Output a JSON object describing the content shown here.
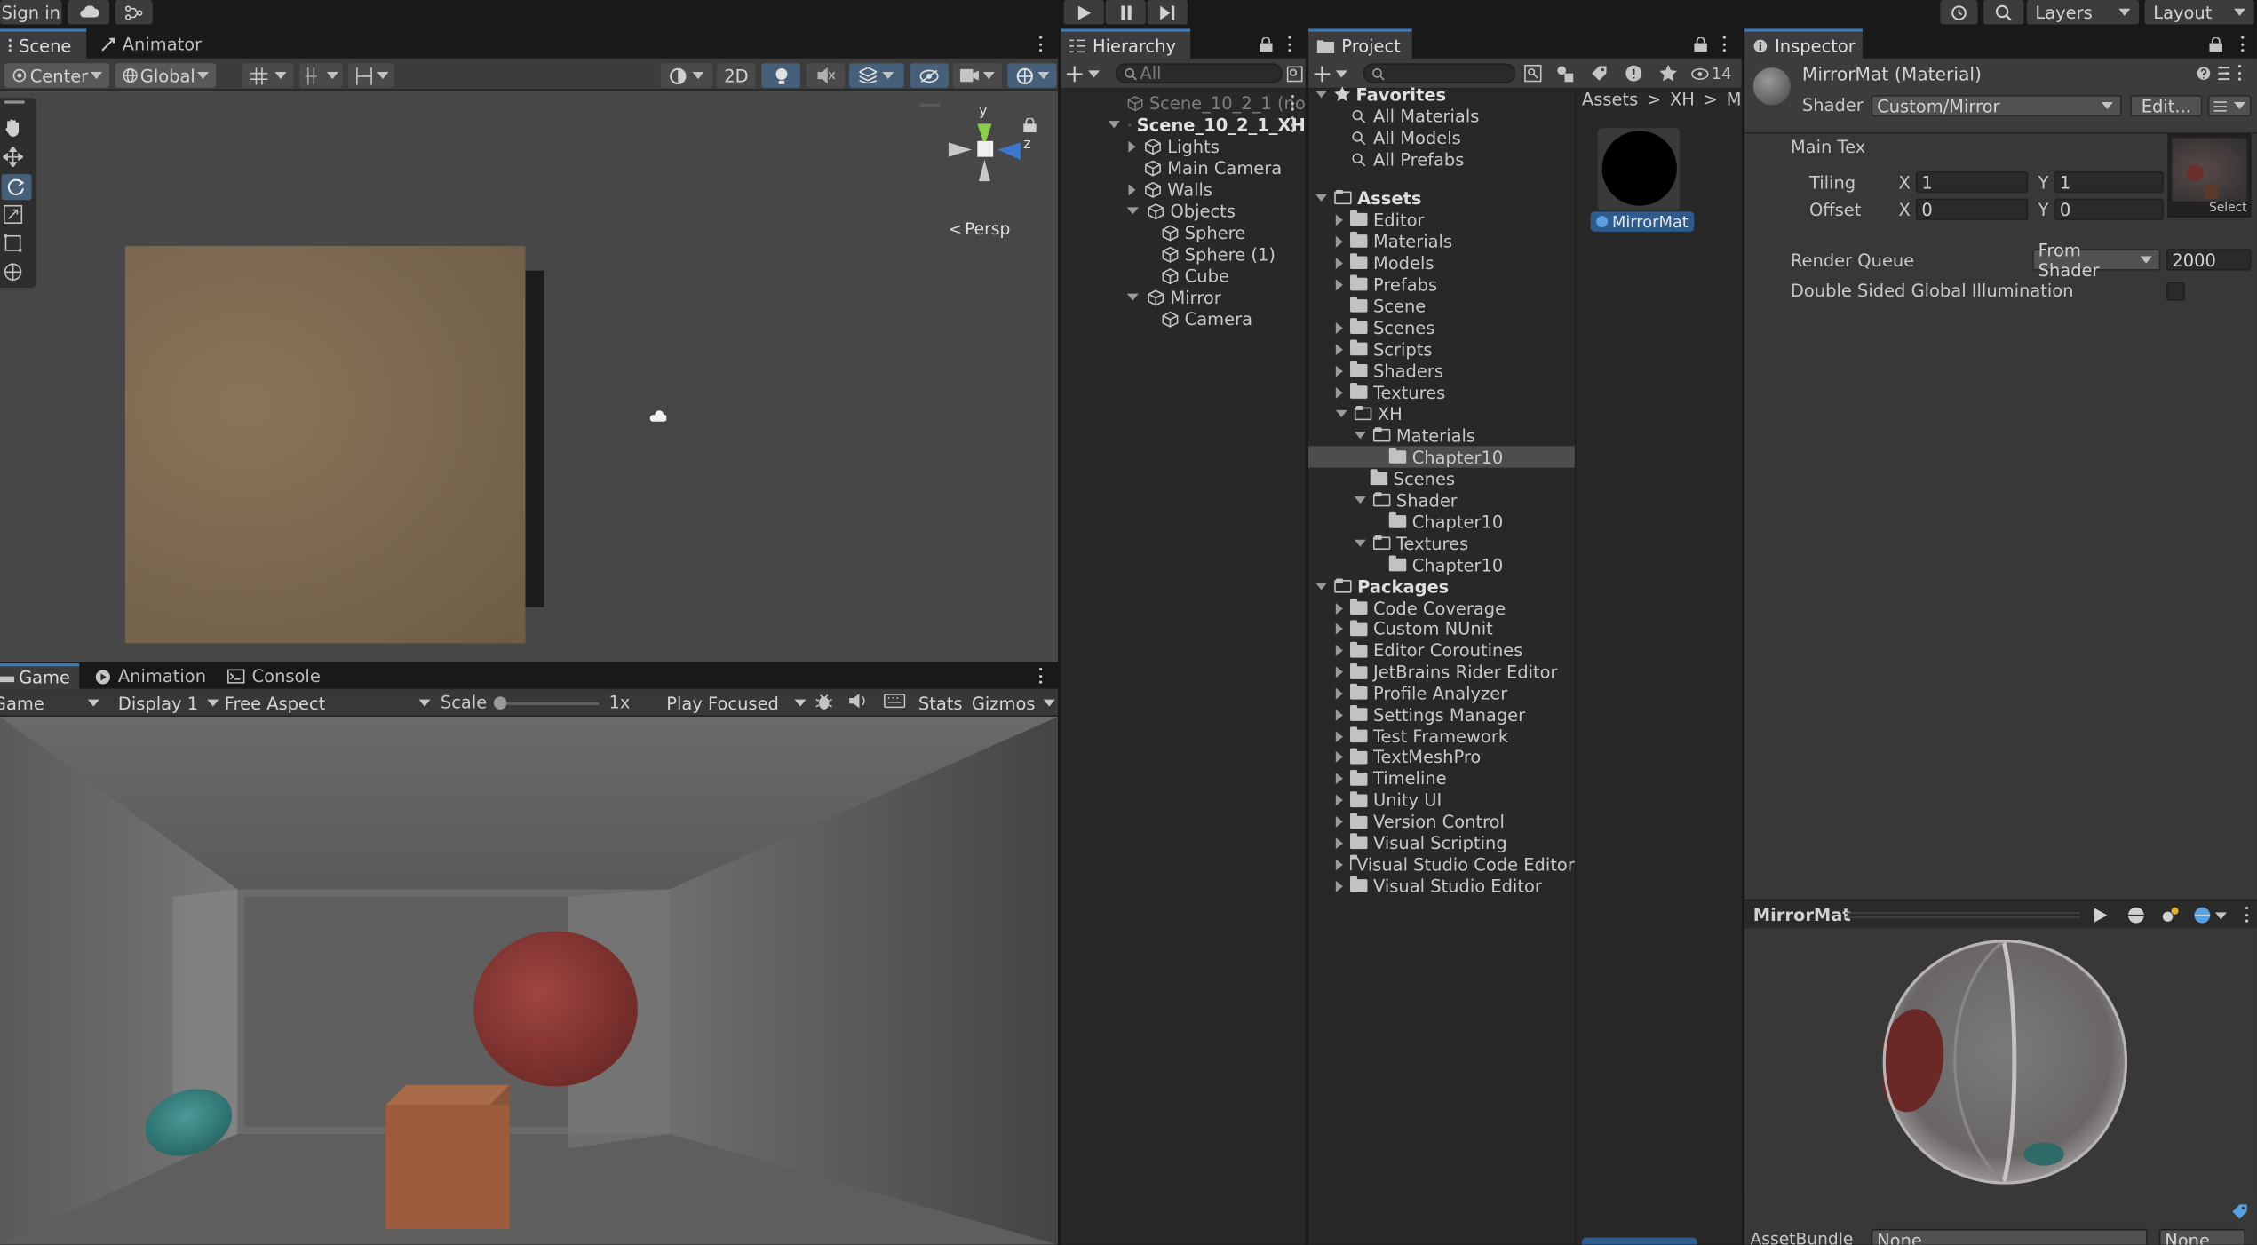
{
  "topbar": {
    "sign_in": "Sign in",
    "layers": "Layers",
    "layout": "Layout"
  },
  "scene": {
    "tabs": [
      "Scene",
      "Animator"
    ],
    "pivot": "Center",
    "space": "Global",
    "mode_2d": "2D",
    "persp": "Persp",
    "gizmo": {
      "y": "y",
      "z": "z"
    }
  },
  "game": {
    "tabs": [
      "Game",
      "Animation",
      "Console"
    ],
    "view": "Game",
    "display": "Display 1",
    "aspect": "Free Aspect",
    "scale_label": "Scale",
    "scale_value": "1x",
    "play_mode": "Play Focused",
    "stats": "Stats",
    "gizmos": "Gizmos"
  },
  "hierarchy": {
    "title": "Hierarchy",
    "search_placeholder": "All",
    "items": [
      {
        "label": "Scene_10_2_1 (no",
        "depth": 0
      },
      {
        "label": "Scene_10_2_1_XH",
        "depth": 0
      },
      {
        "label": "Lights",
        "depth": 1
      },
      {
        "label": "Main Camera",
        "depth": 1
      },
      {
        "label": "Walls",
        "depth": 1
      },
      {
        "label": "Objects",
        "depth": 1
      },
      {
        "label": "Sphere",
        "depth": 2
      },
      {
        "label": "Sphere (1)",
        "depth": 2
      },
      {
        "label": "Cube",
        "depth": 2
      },
      {
        "label": "Mirror",
        "depth": 1
      },
      {
        "label": "Camera",
        "depth": 2
      }
    ]
  },
  "project": {
    "title": "Project",
    "hidden_count": "14",
    "breadcrumb": [
      "Assets",
      "XH",
      "Mate"
    ],
    "favorites": {
      "label": "Favorites",
      "items": [
        "All Materials",
        "All Models",
        "All Prefabs"
      ]
    },
    "assets": {
      "label": "Assets",
      "items": [
        "Editor",
        "Materials",
        "Models",
        "Prefabs",
        "Scene",
        "Scenes",
        "Scripts",
        "Shaders",
        "Textures",
        "XH",
        "Materials",
        "Chapter10",
        "Scenes",
        "Shader",
        "Chapter10",
        "Textures",
        "Chapter10"
      ]
    },
    "packages": {
      "label": "Packages",
      "items": [
        "Code Coverage",
        "Custom NUnit",
        "Editor Coroutines",
        "JetBrains Rider Editor",
        "Profile Analyzer",
        "Settings Manager",
        "Test Framework",
        "TextMeshPro",
        "Timeline",
        "Unity UI",
        "Version Control",
        "Visual Scripting",
        "Visual Studio Code Editor",
        "Visual Studio Editor"
      ]
    },
    "asset_item": "MirrorMat"
  },
  "inspector": {
    "title": "Inspector",
    "object_name": "MirrorMat (Material)",
    "shader_label": "Shader",
    "shader_value": "Custom/Mirror",
    "edit_button": "Edit...",
    "main_tex": "Main Tex",
    "tiling_label": "Tiling",
    "offset_label": "Offset",
    "x": "X",
    "y": "Y",
    "tiling_x": "1",
    "tiling_y": "1",
    "offset_x": "0",
    "offset_y": "0",
    "select": "Select",
    "render_queue_label": "Render Queue",
    "render_queue_mode": "From Shader",
    "render_queue_value": "2000",
    "double_sided_gi": "Double Sided Global Illumination",
    "preview_title": "MirrorMat",
    "assetbundle_label": "AssetBundle",
    "assetbundle_value": "None",
    "assetbundle_variant": "None"
  }
}
